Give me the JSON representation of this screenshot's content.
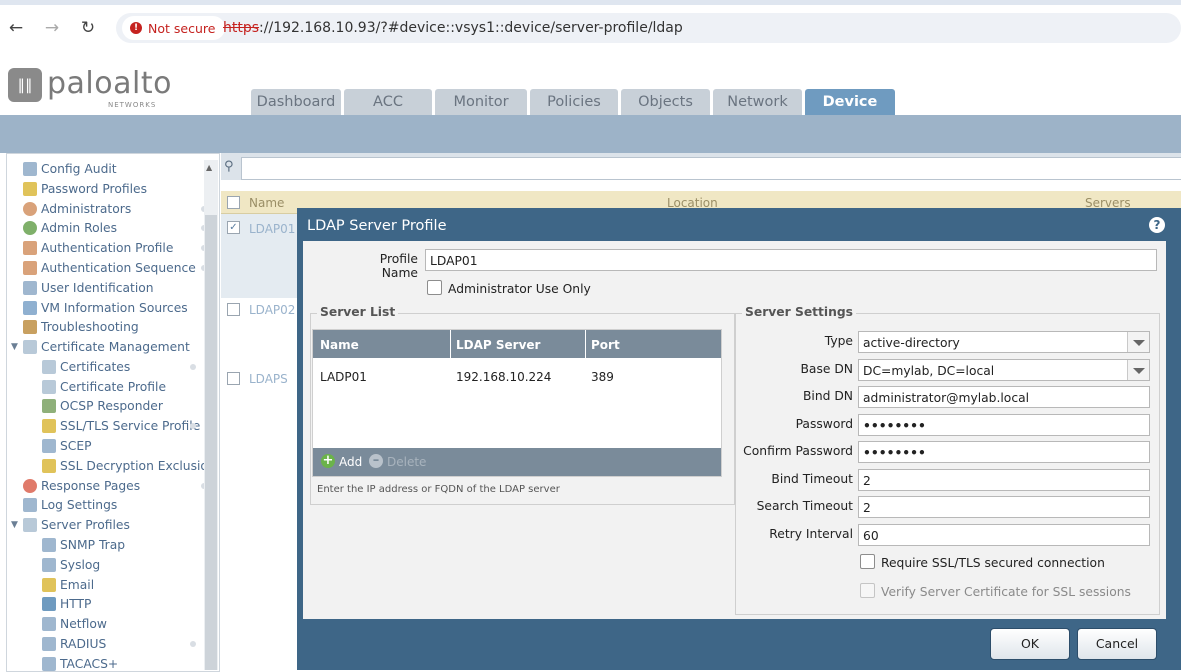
{
  "browser": {
    "back_icon": "arrow-left",
    "forward_icon": "arrow-right",
    "reload_icon": "reload",
    "security_label": "Not secure",
    "url_protocol": "https",
    "url_rest": "://192.168.10.93/?#device::vsys1::device/server-profile/ldap"
  },
  "app": {
    "logo_text": "paloalto",
    "logo_sub": "NETWORKS",
    "tabs": [
      {
        "label": "Dashboard"
      },
      {
        "label": "ACC"
      },
      {
        "label": "Monitor"
      },
      {
        "label": "Policies"
      },
      {
        "label": "Objects"
      },
      {
        "label": "Network"
      },
      {
        "label": "Device"
      }
    ],
    "active_tab": "Device"
  },
  "sidebar": {
    "items": [
      {
        "label": "Config Audit",
        "icon": "config-audit-icon"
      },
      {
        "label": "Password Profiles",
        "icon": "password-icon"
      },
      {
        "label": "Administrators",
        "icon": "admin-user-icon"
      },
      {
        "label": "Admin Roles",
        "icon": "admin-role-icon"
      },
      {
        "label": "Authentication Profile",
        "icon": "auth-profile-icon"
      },
      {
        "label": "Authentication Sequence",
        "icon": "auth-sequence-icon"
      },
      {
        "label": "User Identification",
        "icon": "user-id-icon"
      },
      {
        "label": "VM Information Sources",
        "icon": "vm-icon"
      },
      {
        "label": "Troubleshooting",
        "icon": "tools-icon"
      },
      {
        "label": "Certificate Management",
        "icon": "certificate-folder-icon"
      },
      {
        "label": "Certificates",
        "icon": "certificate-icon"
      },
      {
        "label": "Certificate Profile",
        "icon": "certificate-profile-icon"
      },
      {
        "label": "OCSP Responder",
        "icon": "ocsp-icon"
      },
      {
        "label": "SSL/TLS Service Profile",
        "icon": "lock-icon"
      },
      {
        "label": "SCEP",
        "icon": "scep-icon"
      },
      {
        "label": "SSL Decryption Exclusion",
        "icon": "lock-icon"
      },
      {
        "label": "Response Pages",
        "icon": "no-entry-icon"
      },
      {
        "label": "Log Settings",
        "icon": "log-icon"
      },
      {
        "label": "Server Profiles",
        "icon": "server-folder-icon"
      },
      {
        "label": "SNMP Trap",
        "icon": "server-profile-icon"
      },
      {
        "label": "Syslog",
        "icon": "server-profile-icon"
      },
      {
        "label": "Email",
        "icon": "email-icon"
      },
      {
        "label": "HTTP",
        "icon": "http-icon"
      },
      {
        "label": "Netflow",
        "icon": "server-profile-icon"
      },
      {
        "label": "RADIUS",
        "icon": "server-profile-icon"
      },
      {
        "label": "TACACS+",
        "icon": "server-profile-icon"
      }
    ]
  },
  "grid": {
    "columns": [
      "Name",
      "Location",
      "Servers"
    ],
    "rows": [
      {
        "name": "LDAP01",
        "checked": true
      },
      {
        "name": "LDAP02",
        "checked": false
      },
      {
        "name": "LDAPS",
        "checked": false
      }
    ]
  },
  "dialog": {
    "title": "LDAP Server Profile",
    "profile_name_label": "Profile Name",
    "profile_name_value": "LDAP01",
    "admin_only_label": "Administrator Use Only",
    "server_list": {
      "legend": "Server List",
      "columns": [
        "Name",
        "LDAP Server",
        "Port"
      ],
      "rows": [
        [
          "LADP01",
          "192.168.10.224",
          "389"
        ]
      ],
      "add_label": "Add",
      "delete_label": "Delete",
      "hint": "Enter the IP address or FQDN of the LDAP server"
    },
    "settings": {
      "legend": "Server Settings",
      "type_label": "Type",
      "type_value": "active-directory",
      "base_dn_label": "Base DN",
      "base_dn_value": "DC=mylab, DC=local",
      "bind_dn_label": "Bind DN",
      "bind_dn_value": "administrator@mylab.local",
      "password_label": "Password",
      "password_value": "••••••••",
      "confirm_password_label": "Confirm Password",
      "confirm_password_value": "••••••••",
      "bind_timeout_label": "Bind Timeout",
      "bind_timeout_value": "2",
      "search_timeout_label": "Search Timeout",
      "search_timeout_value": "2",
      "retry_interval_label": "Retry Interval",
      "retry_interval_value": "60",
      "require_ssl_label": "Require SSL/TLS secured connection",
      "verify_cert_label": "Verify Server Certificate for SSL sessions"
    },
    "ok_label": "OK",
    "cancel_label": "Cancel"
  },
  "colors": {
    "dialog_blue": "#3e6687",
    "active_tab": "#6f9bc0",
    "grid_header": "#f0e7c4"
  }
}
